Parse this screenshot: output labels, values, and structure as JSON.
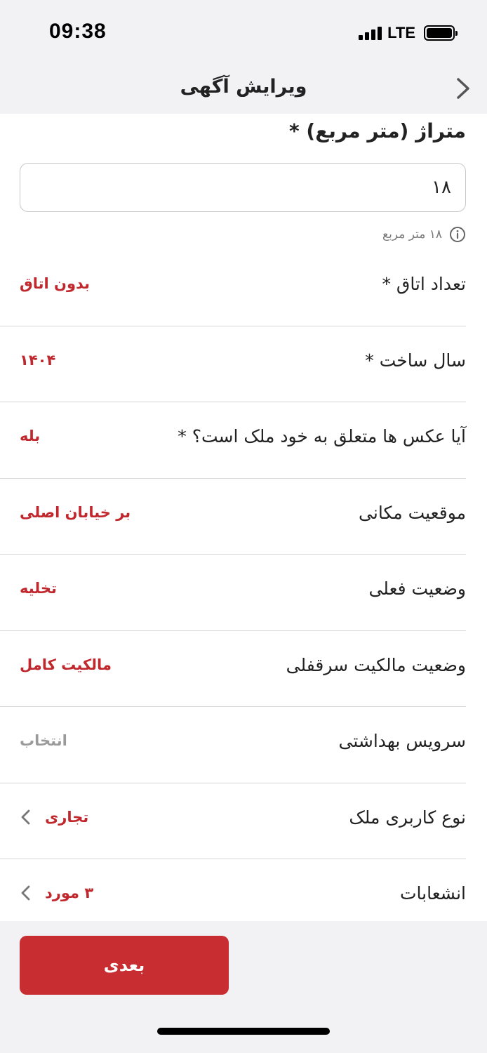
{
  "status": {
    "time": "09:38",
    "network": "LTE"
  },
  "nav": {
    "title": "ویرایش آگهی",
    "back_icon": "chevron-right-icon"
  },
  "area": {
    "label": "متراژ (متر مربع) *",
    "value": "۱۸",
    "hint": "۱۸ متر مربع",
    "hint_icon": "info-icon"
  },
  "rows": [
    {
      "label": "تعداد اتاق *",
      "value": "بدون اتاق",
      "placeholder": false,
      "chevron": false
    },
    {
      "label": "سال ساخت *",
      "value": "۱۴۰۴",
      "placeholder": false,
      "chevron": false
    },
    {
      "label": "آیا عکس ها متعلق به خود ملک است؟ *",
      "value": "بله",
      "placeholder": false,
      "chevron": false
    },
    {
      "label": "موقعیت مکانی",
      "value": "بر خیابان اصلی",
      "placeholder": false,
      "chevron": false
    },
    {
      "label": "وضعیت فعلی",
      "value": "تخلیه",
      "placeholder": false,
      "chevron": false
    },
    {
      "label": "وضعیت مالکیت سرقفلی",
      "value": "مالکیت کامل",
      "placeholder": false,
      "chevron": false
    },
    {
      "label": "سرویس بهداشتی",
      "value": "انتخاب",
      "placeholder": true,
      "chevron": false
    },
    {
      "label": "نوع کاربری ملک",
      "value": "تجاری",
      "placeholder": false,
      "chevron": true
    },
    {
      "label": "انشعابات",
      "value": "۳ مورد",
      "placeholder": false,
      "chevron": true
    }
  ],
  "footer": {
    "next_label": "بعدی"
  },
  "colors": {
    "accent": "#c82d32",
    "value_red": "#c0282d",
    "placeholder_gray": "#9a9a9a",
    "bar_bg": "#f2f2f4"
  }
}
